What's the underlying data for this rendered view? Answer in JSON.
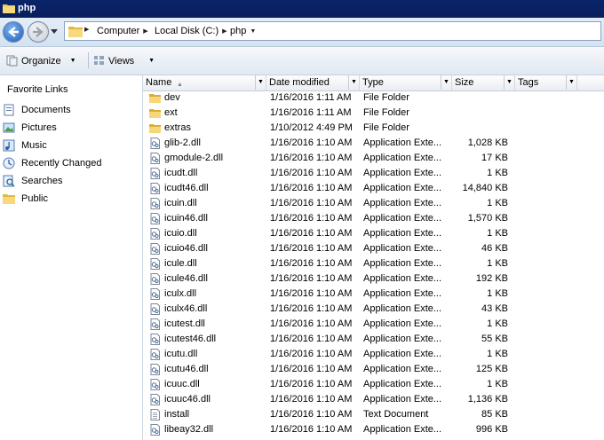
{
  "window": {
    "title": "php"
  },
  "address": {
    "crumbs": [
      "Computer",
      "Local Disk (C:)",
      "php"
    ]
  },
  "toolbar": {
    "organize_label": "Organize",
    "views_label": "Views"
  },
  "sidebar": {
    "title": "Favorite Links",
    "items": [
      {
        "label": "Documents",
        "icon": "documents-icon"
      },
      {
        "label": "Pictures",
        "icon": "pictures-icon"
      },
      {
        "label": "Music",
        "icon": "music-icon"
      },
      {
        "label": "Recently Changed",
        "icon": "recent-icon"
      },
      {
        "label": "Searches",
        "icon": "search-icon"
      },
      {
        "label": "Public",
        "icon": "folder-icon"
      }
    ]
  },
  "columns": [
    "Name",
    "Date modified",
    "Type",
    "Size",
    "Tags"
  ],
  "files": [
    {
      "name": "dev",
      "date": "1/16/2016 1:11 AM",
      "type": "File Folder",
      "size": "",
      "kind": "folder"
    },
    {
      "name": "ext",
      "date": "1/16/2016 1:11 AM",
      "type": "File Folder",
      "size": "",
      "kind": "folder"
    },
    {
      "name": "extras",
      "date": "1/10/2012 4:49 PM",
      "type": "File Folder",
      "size": "",
      "kind": "folder"
    },
    {
      "name": "glib-2.dll",
      "date": "1/16/2016 1:10 AM",
      "type": "Application Exte...",
      "size": "1,028 KB",
      "kind": "dll"
    },
    {
      "name": "gmodule-2.dll",
      "date": "1/16/2016 1:10 AM",
      "type": "Application Exte...",
      "size": "17 KB",
      "kind": "dll"
    },
    {
      "name": "icudt.dll",
      "date": "1/16/2016 1:10 AM",
      "type": "Application Exte...",
      "size": "1 KB",
      "kind": "dll"
    },
    {
      "name": "icudt46.dll",
      "date": "1/16/2016 1:10 AM",
      "type": "Application Exte...",
      "size": "14,840 KB",
      "kind": "dll"
    },
    {
      "name": "icuin.dll",
      "date": "1/16/2016 1:10 AM",
      "type": "Application Exte...",
      "size": "1 KB",
      "kind": "dll"
    },
    {
      "name": "icuin46.dll",
      "date": "1/16/2016 1:10 AM",
      "type": "Application Exte...",
      "size": "1,570 KB",
      "kind": "dll"
    },
    {
      "name": "icuio.dll",
      "date": "1/16/2016 1:10 AM",
      "type": "Application Exte...",
      "size": "1 KB",
      "kind": "dll"
    },
    {
      "name": "icuio46.dll",
      "date": "1/16/2016 1:10 AM",
      "type": "Application Exte...",
      "size": "46 KB",
      "kind": "dll"
    },
    {
      "name": "icule.dll",
      "date": "1/16/2016 1:10 AM",
      "type": "Application Exte...",
      "size": "1 KB",
      "kind": "dll"
    },
    {
      "name": "icule46.dll",
      "date": "1/16/2016 1:10 AM",
      "type": "Application Exte...",
      "size": "192 KB",
      "kind": "dll"
    },
    {
      "name": "iculx.dll",
      "date": "1/16/2016 1:10 AM",
      "type": "Application Exte...",
      "size": "1 KB",
      "kind": "dll"
    },
    {
      "name": "iculx46.dll",
      "date": "1/16/2016 1:10 AM",
      "type": "Application Exte...",
      "size": "43 KB",
      "kind": "dll"
    },
    {
      "name": "icutest.dll",
      "date": "1/16/2016 1:10 AM",
      "type": "Application Exte...",
      "size": "1 KB",
      "kind": "dll"
    },
    {
      "name": "icutest46.dll",
      "date": "1/16/2016 1:10 AM",
      "type": "Application Exte...",
      "size": "55 KB",
      "kind": "dll"
    },
    {
      "name": "icutu.dll",
      "date": "1/16/2016 1:10 AM",
      "type": "Application Exte...",
      "size": "1 KB",
      "kind": "dll"
    },
    {
      "name": "icutu46.dll",
      "date": "1/16/2016 1:10 AM",
      "type": "Application Exte...",
      "size": "125 KB",
      "kind": "dll"
    },
    {
      "name": "icuuc.dll",
      "date": "1/16/2016 1:10 AM",
      "type": "Application Exte...",
      "size": "1 KB",
      "kind": "dll"
    },
    {
      "name": "icuuc46.dll",
      "date": "1/16/2016 1:10 AM",
      "type": "Application Exte...",
      "size": "1,136 KB",
      "kind": "dll"
    },
    {
      "name": "install",
      "date": "1/16/2016 1:10 AM",
      "type": "Text Document",
      "size": "85 KB",
      "kind": "txt"
    },
    {
      "name": "libeay32.dll",
      "date": "1/16/2016 1:10 AM",
      "type": "Application Exte...",
      "size": "996 KB",
      "kind": "dll"
    }
  ]
}
